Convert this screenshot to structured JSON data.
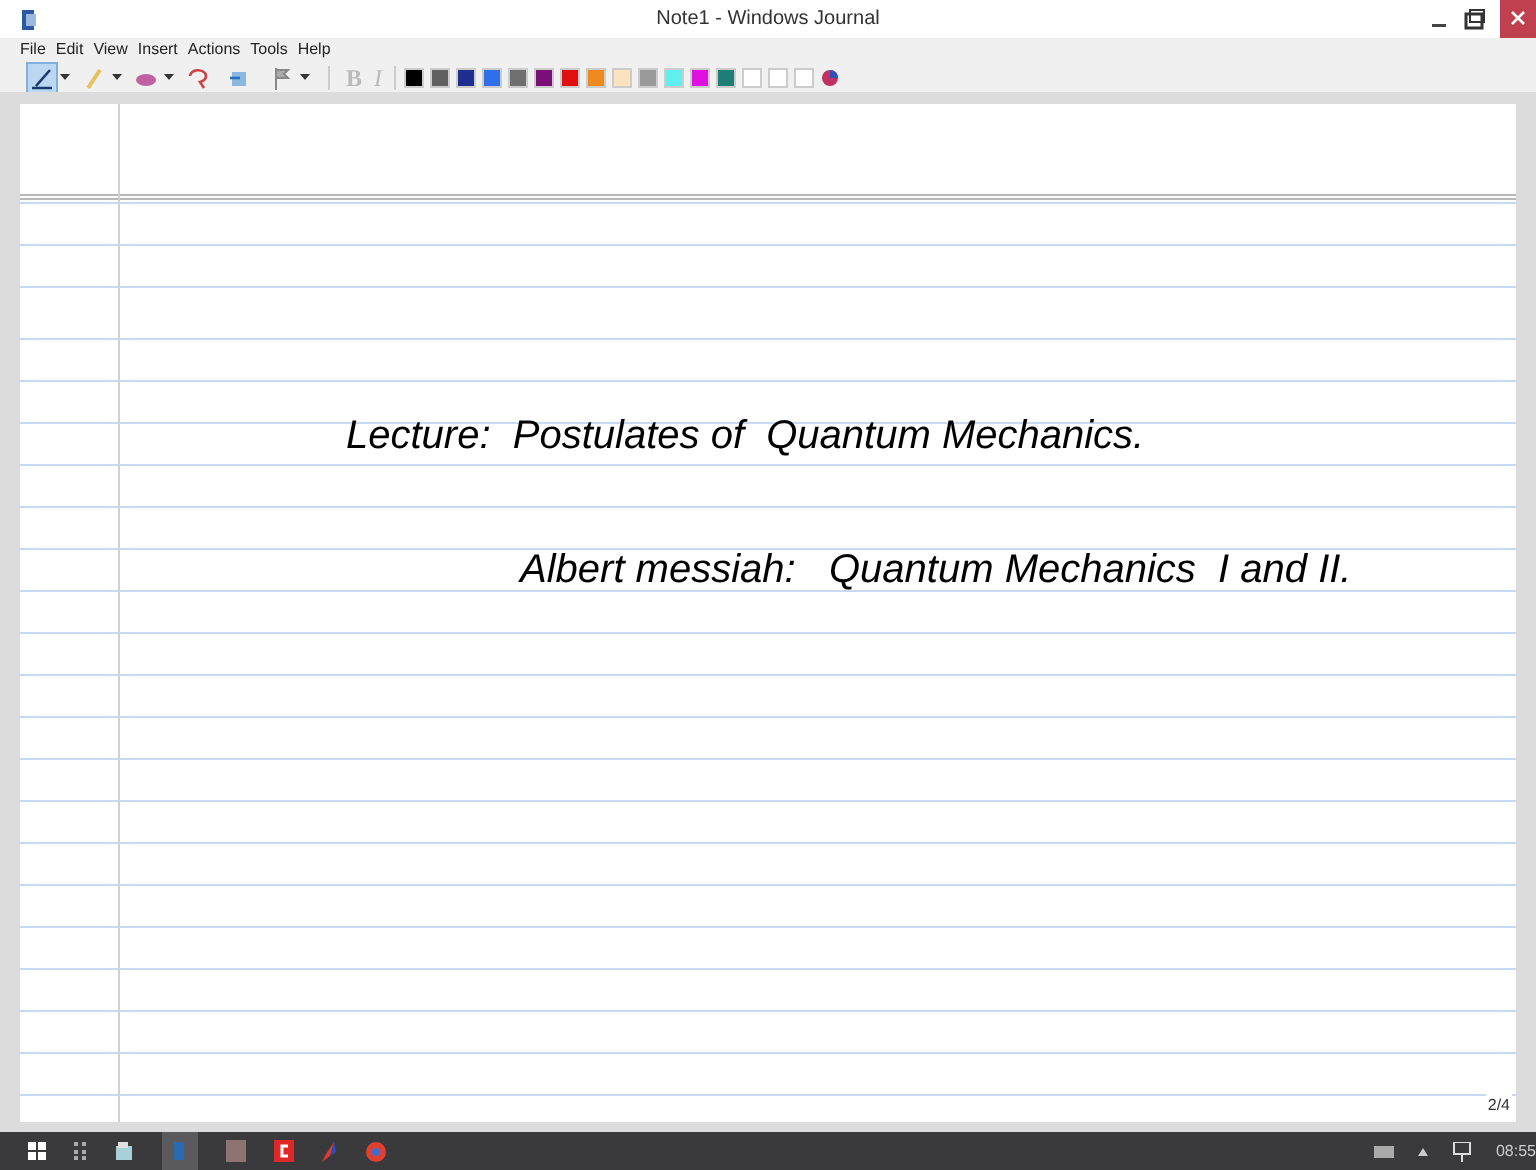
{
  "window": {
    "title": "Note1 - Windows Journal"
  },
  "menu": [
    "File",
    "Edit",
    "View",
    "Insert",
    "Actions",
    "Tools",
    "Help"
  ],
  "tools": [
    {
      "kind": "pen",
      "selected": true,
      "dropdown": true
    },
    {
      "kind": "highlighter",
      "selected": false,
      "dropdown": true
    },
    {
      "kind": "eraser",
      "selected": false,
      "dropdown": true
    },
    {
      "kind": "lasso",
      "selected": false,
      "dropdown": false
    },
    {
      "kind": "space",
      "selected": false,
      "dropdown": false
    },
    {
      "kind": "flag",
      "selected": false,
      "dropdown": true
    }
  ],
  "format_buttons": [
    {
      "kind": "bold",
      "label": "B"
    },
    {
      "kind": "italic",
      "label": "I"
    }
  ],
  "swatches": [
    {
      "color": "#000000"
    },
    {
      "color": "#606060"
    },
    {
      "color": "#1f2f8f"
    },
    {
      "color": "#2f6fe8"
    },
    {
      "color": "#6f6f6f"
    },
    {
      "color": "#7a1077"
    },
    {
      "color": "#e01010"
    },
    {
      "color": "#ef8a20"
    },
    {
      "color": "#fbe3c0"
    },
    {
      "color": "#9a9a9a"
    },
    {
      "color": "#60f0f0"
    },
    {
      "color": "#e010e0"
    },
    {
      "color": "#1f7f78"
    },
    {
      "color": "#ffffff"
    },
    {
      "color": "#ffffff"
    },
    {
      "color": "#ffffff"
    }
  ],
  "page": {
    "ink": [
      {
        "text": "Lecture:  Postulates of  Quantum Mechanics."
      },
      {
        "text": "Albert messiah:   Quantum Mechanics  I and II."
      }
    ],
    "page_number": "2/4"
  },
  "taskbar": {
    "clock": "08:55"
  }
}
